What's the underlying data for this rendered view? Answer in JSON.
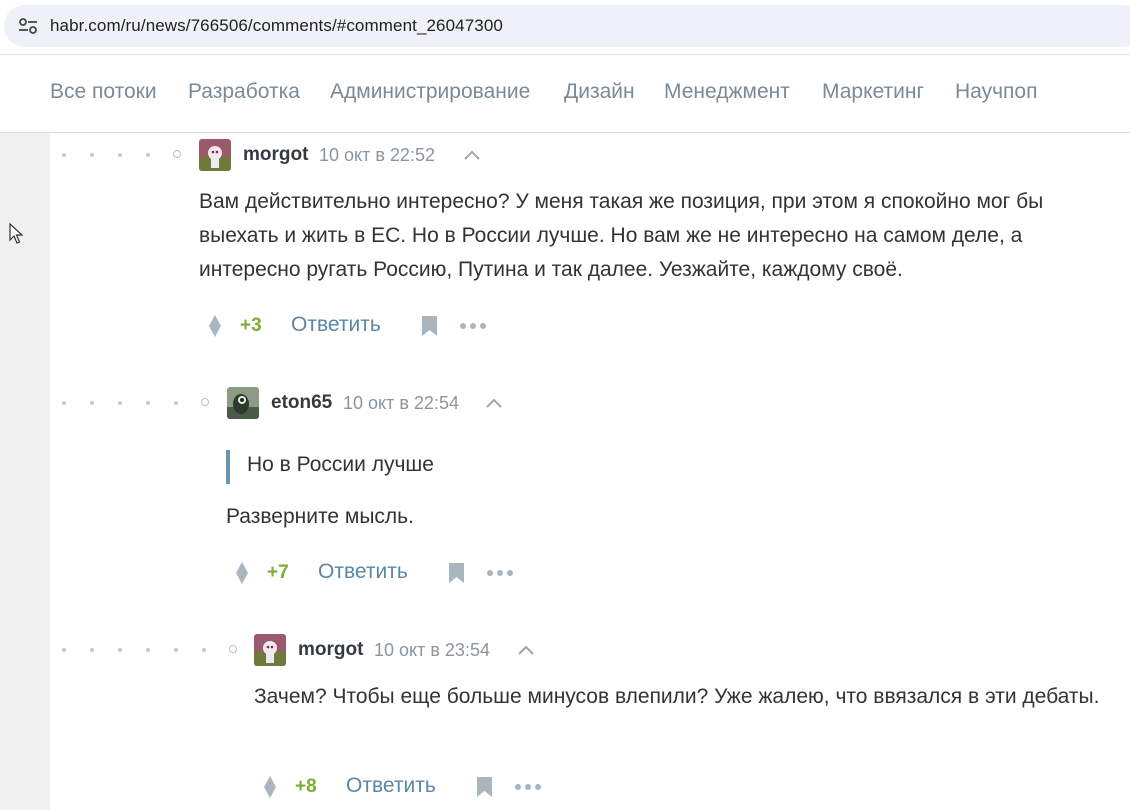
{
  "browser": {
    "url": "habr.com/ru/news/766506/comments/#comment_26047300",
    "site_info_icon": "tune-icon"
  },
  "nav": {
    "items": [
      "Все потоки",
      "Разработка",
      "Администрирование",
      "Дизайн",
      "Менеджмент",
      "Маркетинг",
      "Научпоп"
    ]
  },
  "comments": [
    {
      "author": "morgot",
      "time": "10 окт в 22:52",
      "text": "Вам действительно интересно? У меня такая же позиция, при этом я спокойно мог бы выехать и жить в ЕС. Но в России лучше. Но вам же не интересно на самом деле, а интересно ругать Россию, Путина и так далее. Уезжайте, каждому своё.",
      "score": "+3",
      "reply_label": "Ответить"
    },
    {
      "author": "eton65",
      "time": "10 окт в 22:54",
      "quote": "Но в России лучше",
      "text": "Разверните мысль.",
      "score": "+7",
      "reply_label": "Ответить"
    },
    {
      "author": "morgot",
      "time": "10 окт в 23:54",
      "text": "Зачем? Чтобы еще больше минусов влепили? Уже жалею, что ввязался в эти дебаты.",
      "score": "+8",
      "reply_label": "Ответить"
    }
  ],
  "colors": {
    "score_positive": "#7bae32",
    "link": "#5c86a7",
    "nav_text": "#7b8a97",
    "quote_bar": "#6d95ad"
  }
}
